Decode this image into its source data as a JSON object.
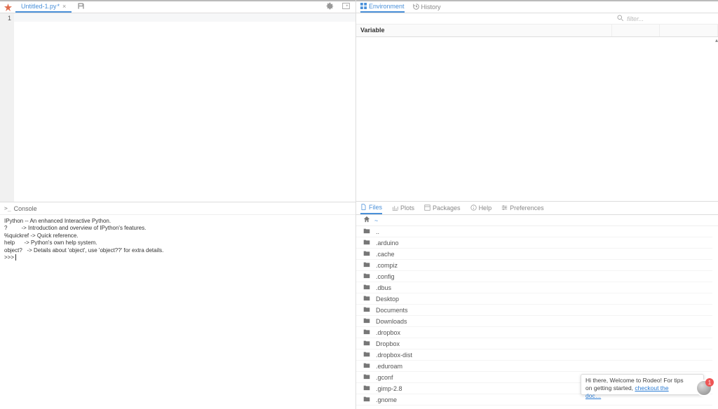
{
  "editor": {
    "tab_label": "Untitled-1.py",
    "tab_dirty": "*",
    "line_number": "1"
  },
  "console": {
    "title": "Console",
    "lines": [
      "IPython -- An enhanced Interactive Python.",
      "?         -> Introduction and overview of IPython's features.",
      "%quickref -> Quick reference.",
      "help      -> Python's own help system.",
      "object?   -> Details about 'object', use 'object??' for extra details.",
      ">>>"
    ]
  },
  "env": {
    "tabs": {
      "environment": "Environment",
      "history": "History"
    },
    "filter_placeholder": "filter...",
    "columns": {
      "variable": "Variable"
    }
  },
  "rb": {
    "tabs": {
      "files": "Files",
      "plots": "Plots",
      "packages": "Packages",
      "help": "Help",
      "preferences": "Preferences"
    },
    "breadcrumb": "~",
    "rows": [
      "..",
      ".arduino",
      ".cache",
      ".compiz",
      ".config",
      ".dbus",
      "Desktop",
      "Documents",
      "Downloads",
      ".dropbox",
      "Dropbox",
      ".dropbox-dist",
      ".eduroam",
      ".gconf",
      ".gimp-2.8",
      ".gnome"
    ]
  },
  "chat": {
    "text_pre": "Hi there, Welcome to Rodeo! For tips on getting started, ",
    "link": "checkout the doc…",
    "badge": "1"
  }
}
